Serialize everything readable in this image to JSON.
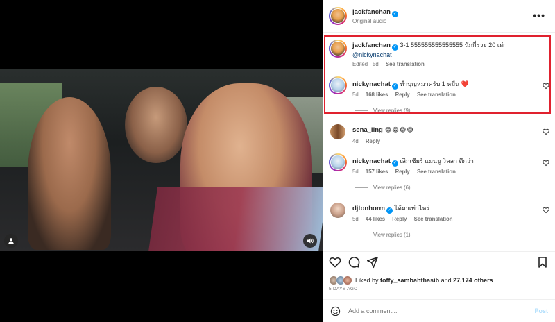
{
  "post": {
    "author": "jackfanchan",
    "audio": "Original audio",
    "more": "•••"
  },
  "comments": [
    {
      "user": "jackfanchan",
      "text": "3-1 555555555555555 นักกี่รวย 20 เท่า",
      "mention": "@nickynachat",
      "age": "Edited · 5d",
      "translate": "See translation"
    },
    {
      "user": "nickynachat",
      "text": "ทำบุญหมาครับ 1 หมื่น ❤️",
      "age": "5d",
      "likes": "168 likes",
      "reply": "Reply",
      "translate": "See translation",
      "replies": "View replies (9)"
    },
    {
      "user": "sena_ling",
      "text": "😂😂😂😂",
      "age": "4d",
      "reply": "Reply"
    },
    {
      "user": "nickynachat",
      "text": "เลิกเชียร์ แมนยู วิลลา ดีกว่า",
      "age": "5d",
      "likes": "157 likes",
      "reply": "Reply",
      "translate": "See translation",
      "replies": "View replies (6)"
    },
    {
      "user": "djtonhorm",
      "text": "ได้มาเท่าไหร่",
      "age": "5d",
      "likes": "44 likes",
      "reply": "Reply",
      "translate": "See translation",
      "replies": "View replies (1)"
    }
  ],
  "likes": {
    "prefix": "Liked by",
    "user": "toffy_sambahthasib",
    "joiner": "and",
    "count": "27,174 others"
  },
  "date": "5 DAYS AGO",
  "composer": {
    "placeholder": "Add a comment...",
    "post": "Post"
  },
  "colors": {
    "highlight_border": "#e0212e",
    "verified": "#0095f6",
    "heart": "#ed4956"
  }
}
